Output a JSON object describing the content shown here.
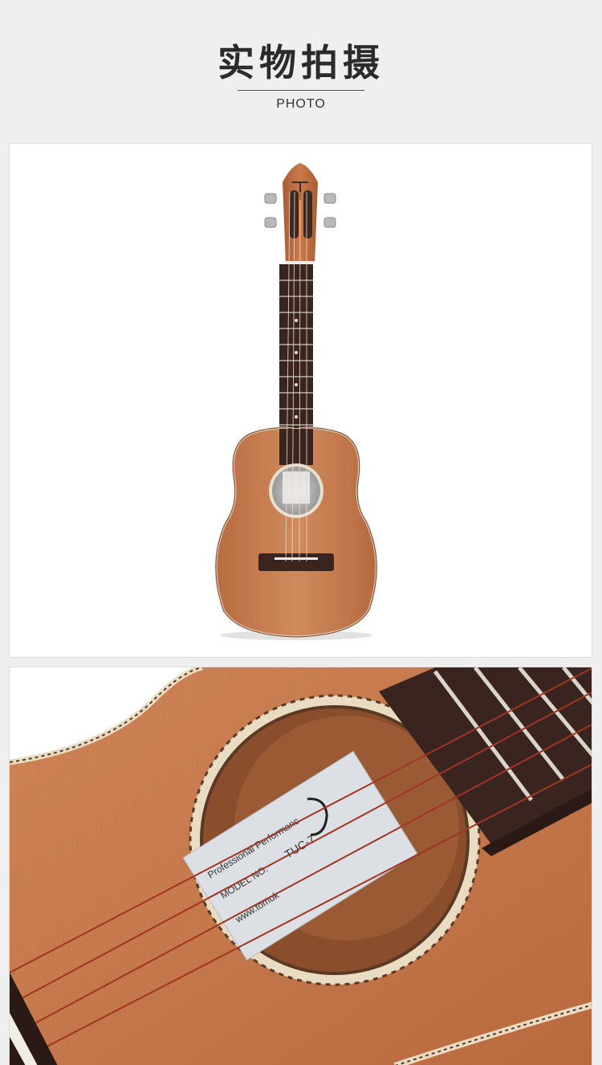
{
  "header": {
    "title": "实物拍摄",
    "subtitle": "PHOTO"
  },
  "label": {
    "line1": "Professional Performanc",
    "line2": "MODEL NO.",
    "line3": "TUC-7",
    "line4": "www.tomuk"
  },
  "colors": {
    "background": "#efefef",
    "wood": "#c77b4e",
    "fretboard": "#3a2420"
  }
}
